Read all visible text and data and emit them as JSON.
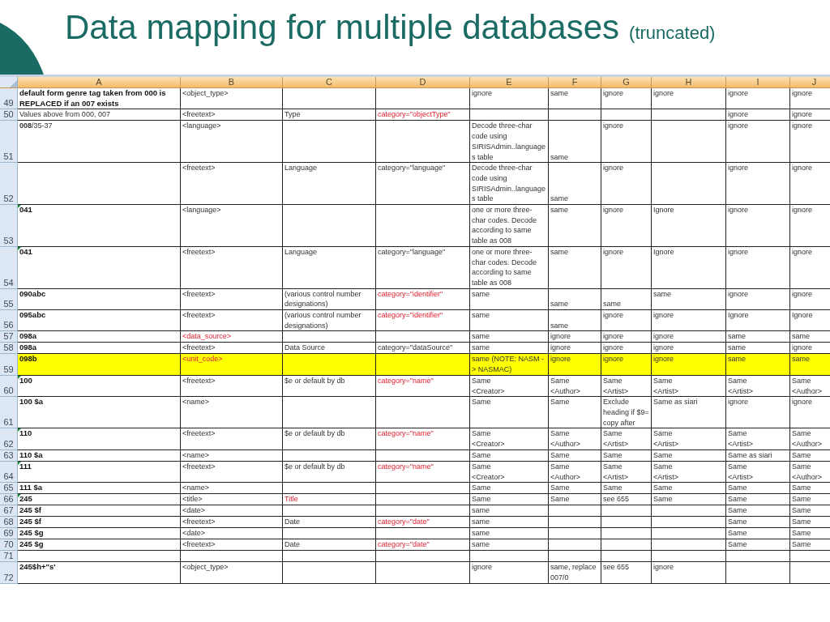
{
  "slide": {
    "title": "Data mapping for multiple databases",
    "subtitle": "(truncated)"
  },
  "sheet": {
    "columns": [
      "A",
      "B",
      "C",
      "D",
      "E",
      "F",
      "G",
      "H",
      "I",
      "J"
    ],
    "rows": [
      {
        "number": "49",
        "highlighted": false,
        "comment_mark": false,
        "cells": [
          {
            "text": "default form genre tag taken from 000 is REPLACED if an 007 exists",
            "kind": "bold"
          },
          {
            "text": "<object_type>",
            "kind": "plain"
          },
          {},
          {},
          {
            "text": "ignore",
            "kind": "plain"
          },
          {
            "text": "same",
            "kind": "plain"
          },
          {
            "text": "ignore",
            "kind": "plain"
          },
          {
            "text": "ignore",
            "kind": "plain"
          },
          {
            "text": "ignore",
            "kind": "plain"
          },
          {
            "text": "ignore",
            "kind": "plain"
          }
        ]
      },
      {
        "number": "50",
        "highlighted": false,
        "comment_mark": false,
        "cells": [
          {
            "text": "Values above from 000, 007",
            "kind": "plain"
          },
          {
            "text": "<freetext>",
            "kind": "plain"
          },
          {
            "text": "Type",
            "kind": "plain"
          },
          {
            "text": "category=\"objectType\"",
            "kind": "red"
          },
          {},
          {},
          {},
          {},
          {
            "text": "ignore",
            "kind": "plain"
          },
          {
            "text": "ignore",
            "kind": "plain"
          }
        ]
      },
      {
        "number": "51",
        "highlighted": false,
        "comment_mark": false,
        "cells": [
          {
            "text": "**008**/35-37",
            "kind": "plain"
          },
          {
            "text": "<language>",
            "kind": "plain"
          },
          {},
          {},
          {
            "text": "Decode three-char code using SIRISAdmin..languages table",
            "kind": "plain"
          },
          {
            "text": "same",
            "kind": "plain",
            "bottom_aligned": true
          },
          {
            "text": "ignore",
            "kind": "plain"
          },
          {},
          {
            "text": "ignore",
            "kind": "plain"
          },
          {
            "text": "ignore",
            "kind": "plain"
          }
        ]
      },
      {
        "number": "52",
        "highlighted": false,
        "comment_mark": false,
        "cells": [
          {},
          {
            "text": "<freetext>",
            "kind": "plain"
          },
          {
            "text": "Language",
            "kind": "plain"
          },
          {
            "text": "category=\"language\"",
            "kind": "plain"
          },
          {
            "text": "Decode three-char code using SIRISAdmin..languages table",
            "kind": "plain"
          },
          {
            "text": "same",
            "kind": "plain",
            "bottom_aligned": true
          },
          {
            "text": "ignore",
            "kind": "plain"
          },
          {},
          {
            "text": "ignore",
            "kind": "plain"
          },
          {
            "text": "ignore",
            "kind": "plain"
          }
        ]
      },
      {
        "number": "53",
        "highlighted": false,
        "comment_mark": true,
        "cells": [
          {
            "text": "041",
            "kind": "bold"
          },
          {
            "text": "<language>",
            "kind": "plain"
          },
          {},
          {},
          {
            "text": "one or more three-char codes.  Decode according to same table as 008",
            "kind": "plain"
          },
          {
            "text": "same",
            "kind": "plain"
          },
          {
            "text": "ignore",
            "kind": "plain"
          },
          {
            "text": "Ignore",
            "kind": "plain"
          },
          {
            "text": "ignore",
            "kind": "plain"
          },
          {
            "text": "ignore",
            "kind": "plain"
          }
        ]
      },
      {
        "number": "54",
        "highlighted": false,
        "comment_mark": true,
        "cells": [
          {
            "text": "041",
            "kind": "bold"
          },
          {
            "text": "<freetext>",
            "kind": "plain"
          },
          {
            "text": "Language",
            "kind": "plain"
          },
          {
            "text": "category=\"language\"",
            "kind": "plain"
          },
          {
            "text": "one or more three-char codes.  Decode according to same table as 008",
            "kind": "plain"
          },
          {
            "text": "same",
            "kind": "plain"
          },
          {
            "text": "ignore",
            "kind": "plain"
          },
          {
            "text": "Ignore",
            "kind": "plain"
          },
          {
            "text": "ignore",
            "kind": "plain"
          },
          {
            "text": "ignore",
            "kind": "plain"
          }
        ]
      },
      {
        "number": "55",
        "highlighted": false,
        "comment_mark": false,
        "cells": [
          {
            "text": "090abc",
            "kind": "bold"
          },
          {
            "text": "<freetext>",
            "kind": "plain"
          },
          {
            "text": "(various control number designations)",
            "kind": "plain"
          },
          {
            "text": "category=\"identifier\"",
            "kind": "red"
          },
          {
            "text": "same",
            "kind": "plain"
          },
          {
            "text": "same",
            "kind": "plain",
            "bottom_aligned": true
          },
          {
            "text": "same",
            "kind": "plain",
            "bottom_aligned": true
          },
          {
            "text": "same",
            "kind": "plain"
          },
          {
            "text": "ignore",
            "kind": "plain"
          },
          {
            "text": "ignore",
            "kind": "plain"
          }
        ]
      },
      {
        "number": "56",
        "highlighted": false,
        "comment_mark": false,
        "cells": [
          {
            "text": "095abc",
            "kind": "bold"
          },
          {
            "text": "<freetext>",
            "kind": "plain"
          },
          {
            "text": "(various control number designations)",
            "kind": "plain"
          },
          {
            "text": "category=\"identifier\"",
            "kind": "red"
          },
          {
            "text": "same",
            "kind": "plain"
          },
          {
            "text": "same",
            "kind": "plain",
            "bottom_aligned": true
          },
          {
            "text": "ignore",
            "kind": "plain"
          },
          {
            "text": "ignore",
            "kind": "plain"
          },
          {
            "text": "Ignore",
            "kind": "plain"
          },
          {
            "text": "Ignore",
            "kind": "plain"
          }
        ]
      },
      {
        "number": "57",
        "highlighted": false,
        "comment_mark": false,
        "cells": [
          {
            "text": "098a",
            "kind": "bold"
          },
          {
            "text": "<data_source>",
            "kind": "red"
          },
          {},
          {},
          {
            "text": "same",
            "kind": "plain"
          },
          {
            "text": "ignore",
            "kind": "plain"
          },
          {
            "text": "ignore",
            "kind": "plain"
          },
          {
            "text": "ignore",
            "kind": "plain"
          },
          {
            "text": "same",
            "kind": "plain"
          },
          {
            "text": "same",
            "kind": "plain"
          }
        ]
      },
      {
        "number": "58",
        "highlighted": false,
        "comment_mark": false,
        "cells": [
          {
            "text": "098a",
            "kind": "bold"
          },
          {
            "text": "<freetext>",
            "kind": "plain"
          },
          {
            "text": "Data Source",
            "kind": "plain"
          },
          {
            "text": "category=\"dataSource\"",
            "kind": "plain"
          },
          {
            "text": "same",
            "kind": "plain"
          },
          {
            "text": "ignore",
            "kind": "plain"
          },
          {
            "text": "ignore",
            "kind": "plain"
          },
          {
            "text": "ignore",
            "kind": "plain"
          },
          {
            "text": "same",
            "kind": "plain"
          },
          {
            "text": "ignore",
            "kind": "plain"
          }
        ]
      },
      {
        "number": "59",
        "highlighted": true,
        "comment_mark": false,
        "cells": [
          {
            "text": "098b",
            "kind": "bold"
          },
          {
            "text": "<unit_code>",
            "kind": "red"
          },
          {},
          {},
          {
            "text": "same (NOTE:  NASM -> NASMAC)",
            "kind": "plain"
          },
          {
            "text": "ignore",
            "kind": "plain"
          },
          {
            "text": "ignore",
            "kind": "plain"
          },
          {
            "text": "ignore",
            "kind": "plain"
          },
          {
            "text": "same",
            "kind": "plain"
          },
          {
            "text": "same",
            "kind": "plain"
          }
        ]
      },
      {
        "number": "60",
        "highlighted": false,
        "comment_mark": true,
        "cells": [
          {
            "text": "100",
            "kind": "bold"
          },
          {
            "text": "<freetext>",
            "kind": "plain"
          },
          {
            "text": "$e or default by db",
            "kind": "plain"
          },
          {
            "text": "category=\"name\"",
            "kind": "red"
          },
          {
            "text": "Same\n<Creator>",
            "kind": "plain"
          },
          {
            "text": "Same\n<Author>",
            "kind": "plain"
          },
          {
            "text": "Same\n<Artist>",
            "kind": "plain"
          },
          {
            "text": "Same\n<Artist>",
            "kind": "plain"
          },
          {
            "text": "Same\n<Artist>",
            "kind": "plain"
          },
          {
            "text": "Same\n<Author>",
            "kind": "plain"
          }
        ]
      },
      {
        "number": "61",
        "highlighted": false,
        "comment_mark": false,
        "cells": [
          {
            "text": "100 $a",
            "kind": "bold"
          },
          {
            "text": "<name>",
            "kind": "plain"
          },
          {},
          {},
          {
            "text": "Same",
            "kind": "plain"
          },
          {
            "text": "Same",
            "kind": "plain"
          },
          {
            "text": "Exclude heading if $9= copy after",
            "kind": "plain"
          },
          {
            "text": "Same as siari",
            "kind": "plain"
          },
          {
            "text": "ignore",
            "kind": "plain"
          },
          {
            "text": "ignore",
            "kind": "plain"
          }
        ]
      },
      {
        "number": "62",
        "highlighted": false,
        "comment_mark": true,
        "cells": [
          {
            "text": "110",
            "kind": "bold"
          },
          {
            "text": "<freetext>",
            "kind": "plain"
          },
          {
            "text": "$e or default by db",
            "kind": "plain"
          },
          {
            "text": "category=\"name\"",
            "kind": "red"
          },
          {
            "text": "Same\n<Creator>",
            "kind": "plain"
          },
          {
            "text": "Same\n<Author>",
            "kind": "plain"
          },
          {
            "text": "Same\n<Artist>",
            "kind": "plain"
          },
          {
            "text": "Same\n<Artist>",
            "kind": "plain"
          },
          {
            "text": "Same\n<Artist>",
            "kind": "plain"
          },
          {
            "text": "Same\n<Author>",
            "kind": "plain"
          }
        ]
      },
      {
        "number": "63",
        "highlighted": false,
        "comment_mark": false,
        "cells": [
          {
            "text": "110 $a",
            "kind": "bold"
          },
          {
            "text": "<name>",
            "kind": "plain"
          },
          {},
          {},
          {
            "text": "Same",
            "kind": "plain"
          },
          {
            "text": "Same",
            "kind": "plain"
          },
          {
            "text": "Same",
            "kind": "plain"
          },
          {
            "text": "Same",
            "kind": "plain"
          },
          {
            "text": "Same as siari",
            "kind": "plain"
          },
          {
            "text": "Same",
            "kind": "plain"
          }
        ]
      },
      {
        "number": "64",
        "highlighted": false,
        "comment_mark": true,
        "cells": [
          {
            "text": "111",
            "kind": "bold"
          },
          {
            "text": "<freetext>",
            "kind": "plain"
          },
          {
            "text": "$e or default by db",
            "kind": "plain"
          },
          {
            "text": "category=\"name\"",
            "kind": "red"
          },
          {
            "text": "Same\n<Creator>",
            "kind": "plain"
          },
          {
            "text": "Same\n<Author>",
            "kind": "plain"
          },
          {
            "text": "Same\n<Artist>",
            "kind": "plain"
          },
          {
            "text": "Same\n<Artist>",
            "kind": "plain"
          },
          {
            "text": "Same\n<Artist>",
            "kind": "plain"
          },
          {
            "text": "Same\n<Author>",
            "kind": "plain"
          }
        ]
      },
      {
        "number": "65",
        "highlighted": false,
        "comment_mark": false,
        "cells": [
          {
            "text": "111 $a",
            "kind": "bold"
          },
          {
            "text": "<name>",
            "kind": "plain"
          },
          {},
          {},
          {
            "text": "Same",
            "kind": "plain"
          },
          {
            "text": "Same",
            "kind": "plain"
          },
          {
            "text": "Same",
            "kind": "plain"
          },
          {
            "text": "Same",
            "kind": "plain"
          },
          {
            "text": "Same",
            "kind": "plain"
          },
          {
            "text": "Same",
            "kind": "plain"
          }
        ]
      },
      {
        "number": "66",
        "highlighted": false,
        "comment_mark": true,
        "cells": [
          {
            "text": "245",
            "kind": "bold"
          },
          {
            "text": "<title>",
            "kind": "plain"
          },
          {
            "text": "Title",
            "kind": "red"
          },
          {},
          {
            "text": "Same",
            "kind": "plain"
          },
          {
            "text": "Same",
            "kind": "plain"
          },
          {
            "text": "see 655",
            "kind": "plain"
          },
          {
            "text": "Same",
            "kind": "plain"
          },
          {
            "text": "Same",
            "kind": "plain"
          },
          {
            "text": "Same",
            "kind": "plain"
          }
        ]
      },
      {
        "number": "67",
        "highlighted": false,
        "comment_mark": false,
        "cells": [
          {
            "text": "245 $f",
            "kind": "bold"
          },
          {
            "text": "<date>",
            "kind": "plain"
          },
          {},
          {},
          {
            "text": "same",
            "kind": "plain"
          },
          {},
          {},
          {},
          {
            "text": "Same",
            "kind": "plain"
          },
          {
            "text": "Same",
            "kind": "plain"
          }
        ]
      },
      {
        "number": "68",
        "highlighted": false,
        "comment_mark": false,
        "cells": [
          {
            "text": "245 $f",
            "kind": "bold"
          },
          {
            "text": "<freetext>",
            "kind": "plain"
          },
          {
            "text": "Date",
            "kind": "plain"
          },
          {
            "text": "category=\"date\"",
            "kind": "red"
          },
          {
            "text": "same",
            "kind": "plain"
          },
          {},
          {},
          {},
          {
            "text": "Same",
            "kind": "plain"
          },
          {
            "text": "Same",
            "kind": "plain"
          }
        ]
      },
      {
        "number": "69",
        "highlighted": false,
        "comment_mark": false,
        "cells": [
          {
            "text": "245 $g",
            "kind": "bold"
          },
          {
            "text": "<date>",
            "kind": "plain"
          },
          {},
          {},
          {
            "text": "same",
            "kind": "plain"
          },
          {},
          {},
          {},
          {
            "text": "Same",
            "kind": "plain"
          },
          {
            "text": "Same",
            "kind": "plain"
          }
        ]
      },
      {
        "number": "70",
        "highlighted": false,
        "comment_mark": false,
        "cells": [
          {
            "text": "245 $g",
            "kind": "bold"
          },
          {
            "text": "<freetext>",
            "kind": "plain"
          },
          {
            "text": "Date",
            "kind": "plain"
          },
          {
            "text": "category=\"date\"",
            "kind": "red"
          },
          {
            "text": "same",
            "kind": "plain"
          },
          {},
          {},
          {},
          {
            "text": "Same",
            "kind": "plain"
          },
          {
            "text": "Same",
            "kind": "plain"
          }
        ]
      },
      {
        "number": "71",
        "highlighted": false,
        "comment_mark": false,
        "cells": [
          {},
          {},
          {},
          {},
          {},
          {},
          {},
          {},
          {},
          {}
        ]
      },
      {
        "number": "72",
        "highlighted": false,
        "comment_mark": false,
        "cells": [
          {
            "text": "245$h+\"s'",
            "kind": "bold"
          },
          {
            "text": "<object_type>",
            "kind": "plain"
          },
          {},
          {},
          {
            "text": "ignore",
            "kind": "plain"
          },
          {
            "text": "same, replace 007/0",
            "kind": "plain"
          },
          {
            "text": "see 655",
            "kind": "plain"
          },
          {
            "text": "ignore",
            "kind": "plain"
          },
          {},
          {}
        ]
      }
    ]
  }
}
